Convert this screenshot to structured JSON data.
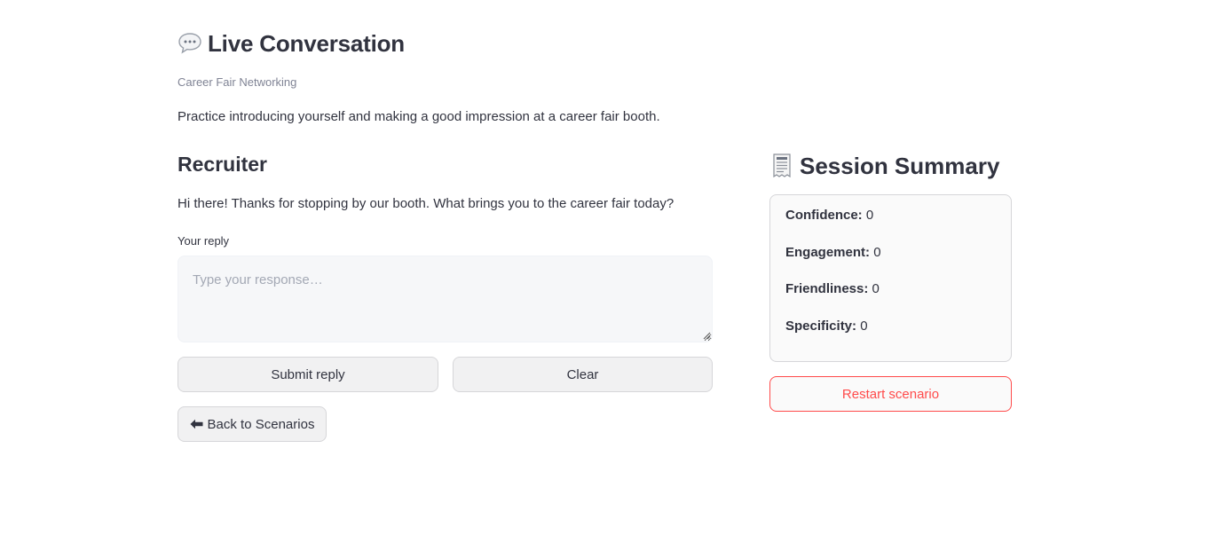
{
  "header": {
    "title": "Live Conversation",
    "title_icon": "speech-bubble-icon",
    "caption": "Career Fair Networking",
    "description": "Practice introducing yourself and making a good impression at a career fair booth."
  },
  "conversation": {
    "speaker": "Recruiter",
    "message": "Hi there! Thanks for stopping by our booth. What brings you to the career fair today?",
    "reply_label": "Your reply",
    "reply_placeholder": "Type your response…",
    "reply_value": ""
  },
  "actions": {
    "submit_label": "Submit reply",
    "clear_label": "Clear",
    "back_label": "Back to Scenarios",
    "back_icon": "left-arrow-icon"
  },
  "summary": {
    "title": "Session Summary",
    "title_icon": "receipt-icon",
    "metrics": [
      {
        "label": "Confidence:",
        "value": "0"
      },
      {
        "label": "Engagement:",
        "value": "0"
      },
      {
        "label": "Friendliness:",
        "value": "0"
      },
      {
        "label": "Specificity:",
        "value": "0"
      }
    ],
    "restart_label": "Restart scenario"
  },
  "colors": {
    "text": "#31333f",
    "muted": "#808495",
    "danger": "#ff4b4b",
    "input_bg": "#f6f7f9",
    "button_bg": "#f1f1f2"
  }
}
